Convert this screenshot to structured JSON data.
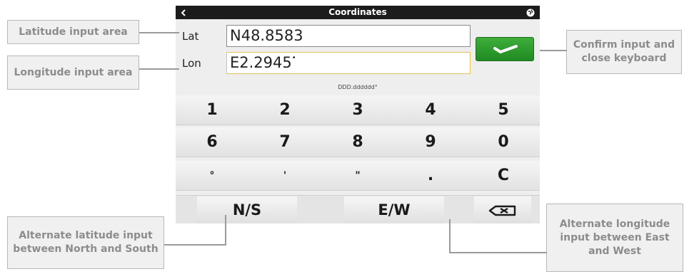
{
  "screen": {
    "title": "Coordinates",
    "lat_label": "Lat",
    "lat_value": "N48.8583",
    "lon_label": "Lon",
    "lon_value": "E2.2945",
    "format_hint": "DDD.dddddd°"
  },
  "keypad": {
    "row1": [
      "1",
      "2",
      "3",
      "4",
      "5"
    ],
    "row2": [
      "6",
      "7",
      "8",
      "9",
      "0"
    ],
    "row3": [
      "°",
      "'",
      "\"",
      ".",
      "C"
    ],
    "ns_label": "N/S",
    "ew_label": "E/W"
  },
  "annotations": {
    "lat": "Latitude input area",
    "lon": "Longitude input area",
    "confirm": "Confirm input and close keyboard",
    "ns": "Alternate latitude input between North and South",
    "ew": "Alternate longitude input between East and West"
  },
  "colors": {
    "confirm_button": "#2e9e2e",
    "titlebar": "#1c1c1c",
    "active_field_border": "#e5c25c"
  },
  "icons": [
    "back-icon",
    "globe-icon",
    "checkmark-icon",
    "backspace-icon"
  ]
}
